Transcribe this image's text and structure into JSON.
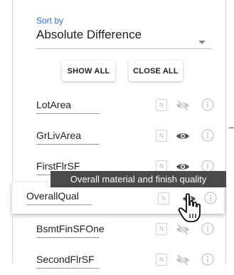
{
  "sort": {
    "label": "Sort by",
    "value": "Absolute Difference"
  },
  "buttons": {
    "show_all": "SHOW ALL",
    "close_all": "CLOSE ALL"
  },
  "features": [
    {
      "name": "LotArea",
      "type_badge": "N",
      "visibility": "hidden"
    },
    {
      "name": "GrLivArea",
      "type_badge": "N",
      "visibility": "visible"
    },
    {
      "name": "FirstFlrSF",
      "type_badge": "N",
      "visibility": "visible"
    },
    {
      "name": "OverallQual",
      "type_badge": "N",
      "visibility": "visible"
    },
    {
      "name": "BsmtFinSFOne",
      "type_badge": "N",
      "visibility": "hidden"
    },
    {
      "name": "SecondFlrSF",
      "type_badge": "N",
      "visibility": "hidden"
    }
  ],
  "tooltip": {
    "text": "Overall material and finish quality"
  },
  "colors": {
    "accent": "#2f6fd6",
    "tooltip_bg": "#4a4a4a",
    "icon_muted": "#c4c4c4",
    "icon_active": "#555555"
  }
}
